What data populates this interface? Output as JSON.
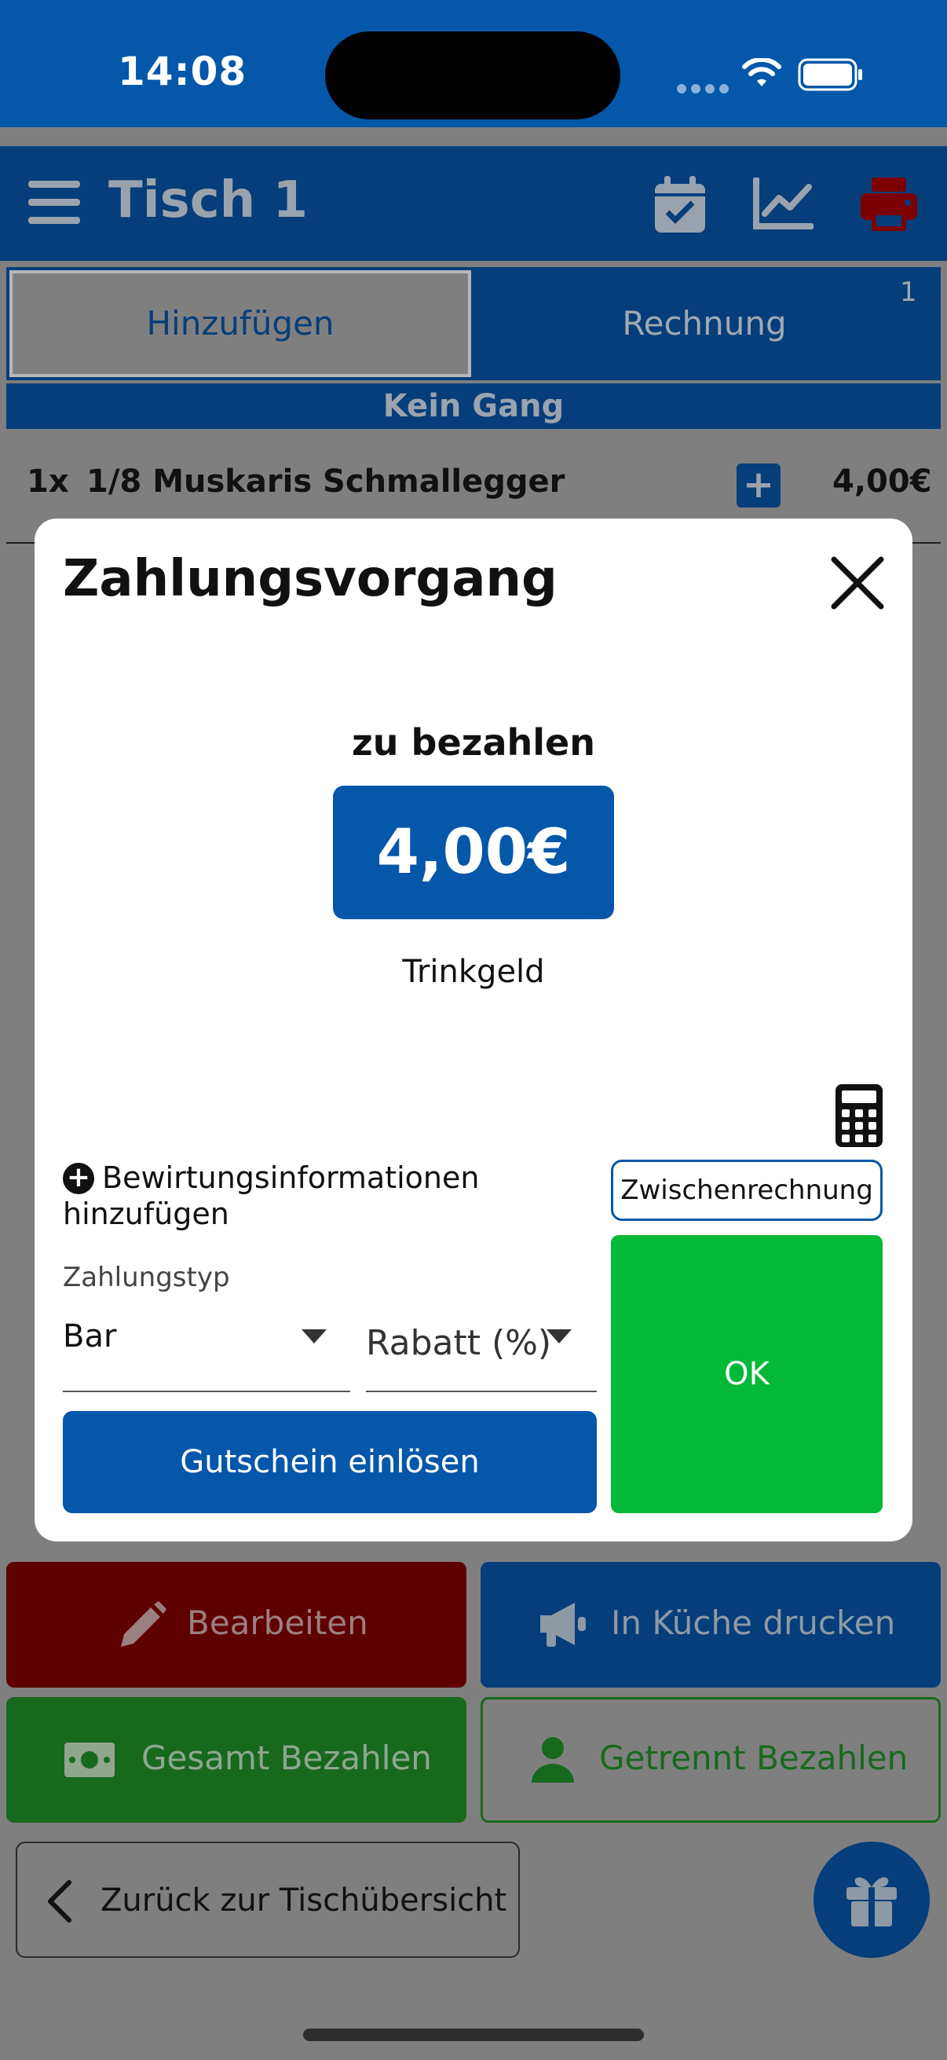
{
  "status_bar": {
    "time": "14:08"
  },
  "header": {
    "title": "Tisch 1"
  },
  "tabs": {
    "add_label": "Hinzufügen",
    "bill_label": "Rechnung",
    "bill_count": "1"
  },
  "course_bar": {
    "label": "Kein Gang"
  },
  "order_items": [
    {
      "qty": "1x",
      "name": "1/8 Muskaris Schmallegger",
      "price": "4,00€"
    }
  ],
  "modal": {
    "title": "Zahlungsvorgang",
    "pay_label": "zu bezahlen",
    "amount": "4,00€",
    "tip_label": "Trinkgeld",
    "hospitality_label": "Bewirtungsinformationen hinzufügen",
    "interim_bill_label": "Zwischenrechnung",
    "payment_type_label": "Zahlungstyp",
    "payment_type_value": "Bar",
    "discount_placeholder": "Rabatt (%)",
    "ok_label": "OK",
    "voucher_label": "Gutschein einlösen"
  },
  "actions": {
    "edit_label": "Bearbeiten",
    "kitchen_label": "In Küche drucken",
    "pay_total_label": "Gesamt Bezahlen",
    "pay_split_label": "Getrennt Bezahlen",
    "back_label": "Zurück zur Tischübersicht"
  },
  "colors": {
    "brand_blue": "#0557aa",
    "ok_green": "#04b838",
    "overlay_grey": "#7f7f7f"
  },
  "icons": [
    "menu-icon",
    "calendar-check-icon",
    "chart-line-icon",
    "printer-icon",
    "close-icon",
    "calculator-icon",
    "plus-circle-icon",
    "pencil-icon",
    "megaphone-icon",
    "money-icon",
    "user-icon",
    "chevron-left-icon",
    "gift-icon"
  ]
}
